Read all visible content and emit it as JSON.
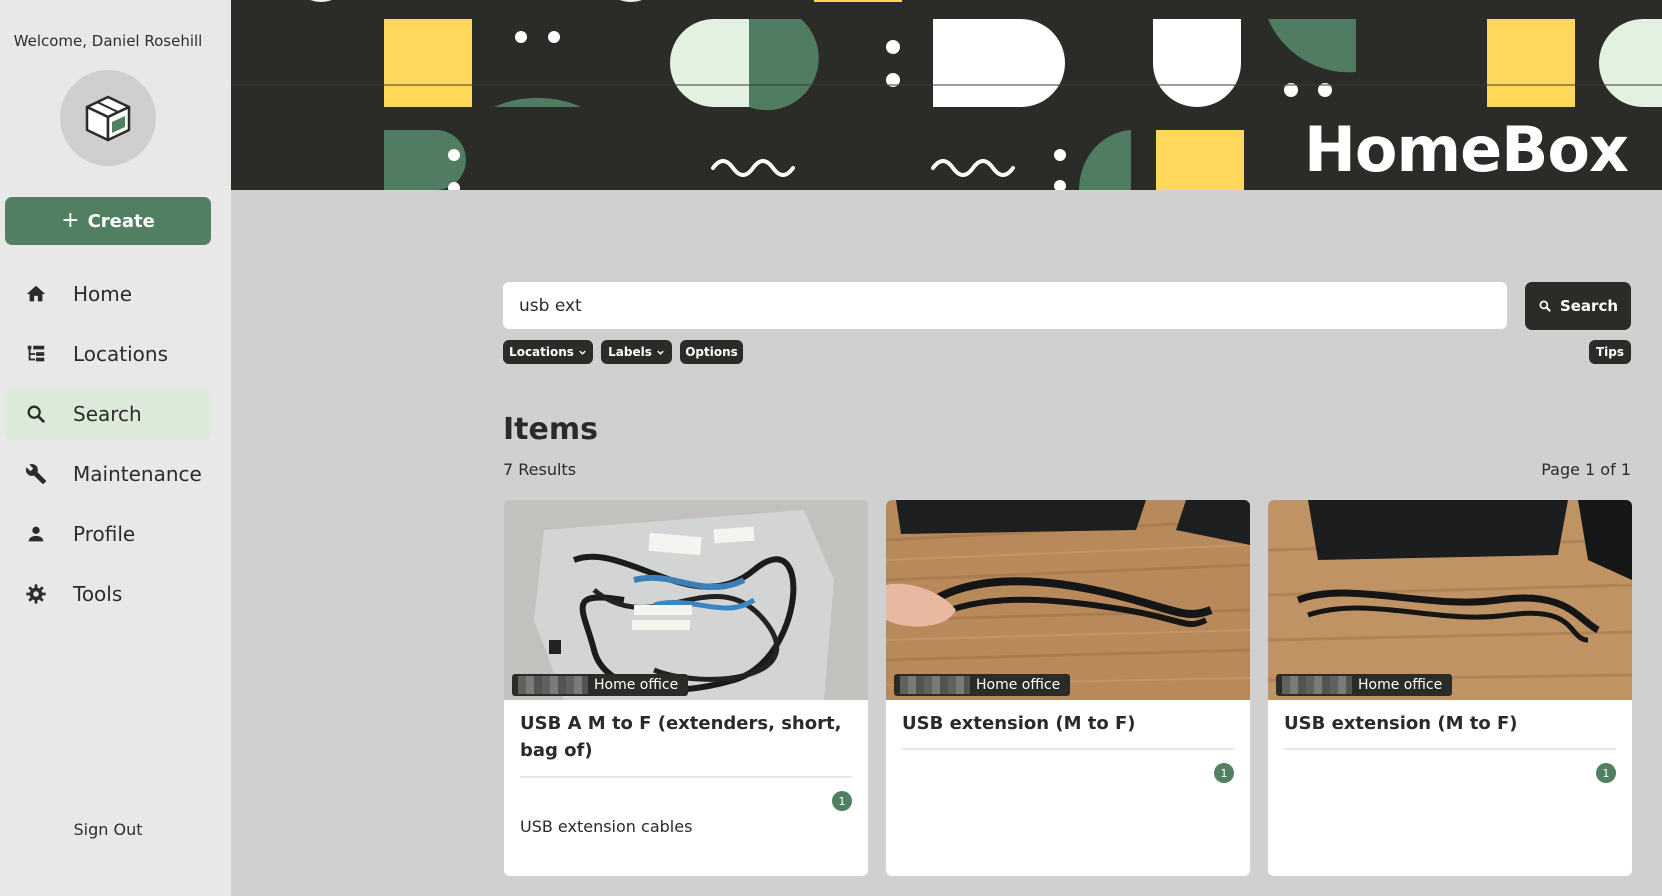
{
  "sidebar": {
    "welcome": "Welcome, Daniel Rosehill",
    "create_label": "Create",
    "items": [
      {
        "label": "Home",
        "icon": "home-icon"
      },
      {
        "label": "Locations",
        "icon": "locations-tree-icon"
      },
      {
        "label": "Search",
        "icon": "search-icon",
        "active": true
      },
      {
        "label": "Maintenance",
        "icon": "wrench-icon"
      },
      {
        "label": "Profile",
        "icon": "person-icon"
      },
      {
        "label": "Tools",
        "icon": "gear-icon"
      }
    ],
    "sign_out": "Sign Out"
  },
  "banner": {
    "logo_text": "HomeBox"
  },
  "search": {
    "value": "usb ext",
    "button_label": "Search"
  },
  "filters": {
    "locations": "Locations",
    "labels": "Labels",
    "options": "Options",
    "tips": "Tips"
  },
  "results": {
    "heading": "Items",
    "count": "7 Results",
    "page": "Page 1 of 1"
  },
  "items": [
    {
      "location": "Home office",
      "title": "USB A M to F (extenders, short, bag of)",
      "quantity": "1",
      "description": "USB extension cables"
    },
    {
      "location": "Home office",
      "title": "USB extension (M to F)",
      "quantity": "1",
      "description": ""
    },
    {
      "location": "Home office",
      "title": "USB extension (M to F)",
      "quantity": "1",
      "description": ""
    }
  ],
  "colors": {
    "accent": "#517f62",
    "dark": "#2b2c28",
    "active_nav": "#dcebd9",
    "banner_yellow": "#ffd75a",
    "banner_green": "#507c61",
    "banner_mint": "#e3f1e0"
  }
}
